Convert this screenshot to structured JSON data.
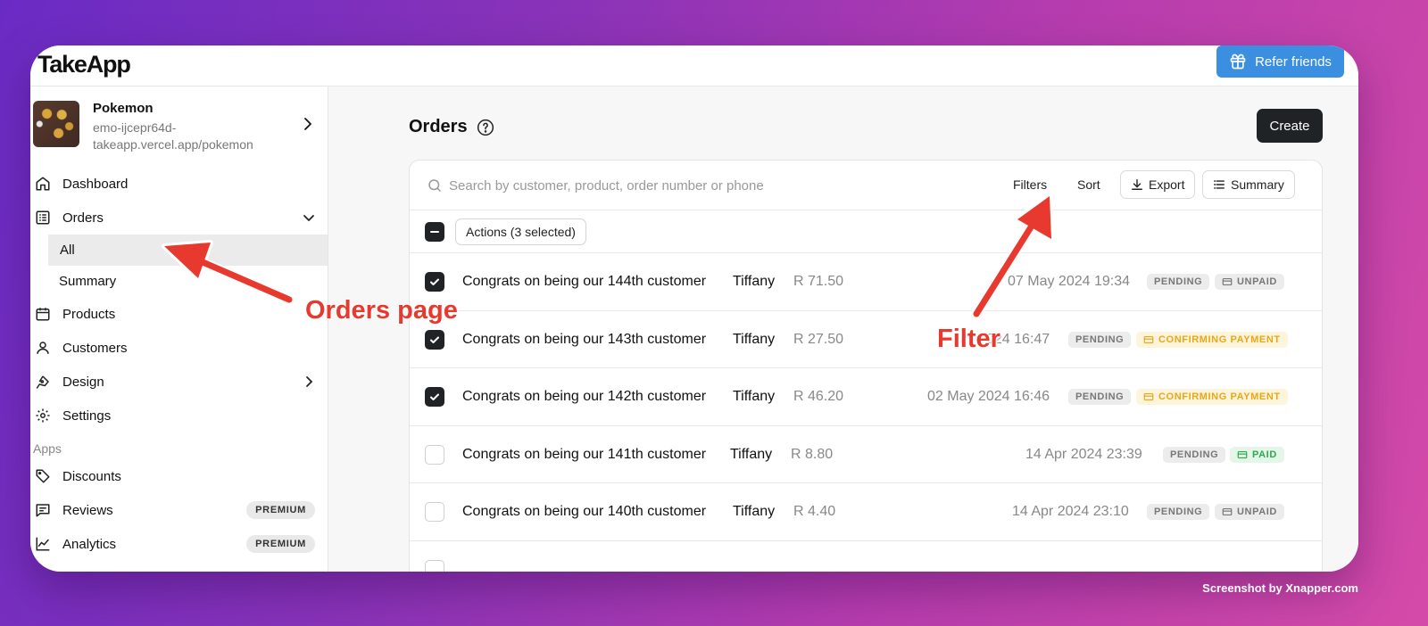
{
  "app": {
    "logo": "TakeApp",
    "refer_label": "Refer friends"
  },
  "store": {
    "name": "Pokemon",
    "url": "emo-ijcepr64d-takeapp.vercel.app/pokemon"
  },
  "sidebar": {
    "items": [
      {
        "label": "Dashboard"
      },
      {
        "label": "Orders"
      },
      {
        "label": "All"
      },
      {
        "label": "Summary"
      },
      {
        "label": "Products"
      },
      {
        "label": "Customers"
      },
      {
        "label": "Design"
      },
      {
        "label": "Settings"
      }
    ],
    "apps_label": "Apps",
    "apps": [
      {
        "label": "Discounts",
        "badge": ""
      },
      {
        "label": "Reviews",
        "badge": "PREMIUM"
      },
      {
        "label": "Analytics",
        "badge": "PREMIUM"
      }
    ]
  },
  "main": {
    "title": "Orders",
    "create_label": "Create",
    "search_placeholder": "Search by customer, product, order number or phone",
    "filters_label": "Filters",
    "sort_label": "Sort",
    "export_label": "Export",
    "summary_label": "Summary",
    "actions_label": "Actions (3 selected)"
  },
  "orders": [
    {
      "title": "Congrats on being our 144th customer",
      "customer": "Tiffany",
      "amount": "R 71.50",
      "date": "07 May 2024 19:34",
      "status": "PENDING",
      "payment": "UNPAID",
      "checked": true
    },
    {
      "title": "Congrats on being our 143th customer",
      "customer": "Tiffany",
      "amount": "R 27.50",
      "date": "024 16:47",
      "status": "PENDING",
      "payment": "CONFIRMING PAYMENT",
      "checked": true
    },
    {
      "title": "Congrats on being our 142th customer",
      "customer": "Tiffany",
      "amount": "R 46.20",
      "date": "02 May 2024 16:46",
      "status": "PENDING",
      "payment": "CONFIRMING PAYMENT",
      "checked": true
    },
    {
      "title": "Congrats on being our 141th customer",
      "customer": "Tiffany",
      "amount": "R 8.80",
      "date": "14 Apr 2024 23:39",
      "status": "PENDING",
      "payment": "PAID",
      "checked": false
    },
    {
      "title": "Congrats on being our 140th customer",
      "customer": "Tiffany",
      "amount": "R 4.40",
      "date": "14 Apr 2024 23:10",
      "status": "PENDING",
      "payment": "UNPAID",
      "checked": false
    }
  ],
  "annotations": {
    "orders_page": "Orders page",
    "filter": "Filter"
  },
  "watermark": "Screenshot by Xnapper.com",
  "colors": {
    "accent_blue": "#3b8fe0",
    "annotation_red": "#e8392e",
    "dark_button": "#1f2326",
    "pending_grey": "#777777",
    "confirming_yellow": "#e6a817",
    "paid_green": "#2fa94e"
  }
}
